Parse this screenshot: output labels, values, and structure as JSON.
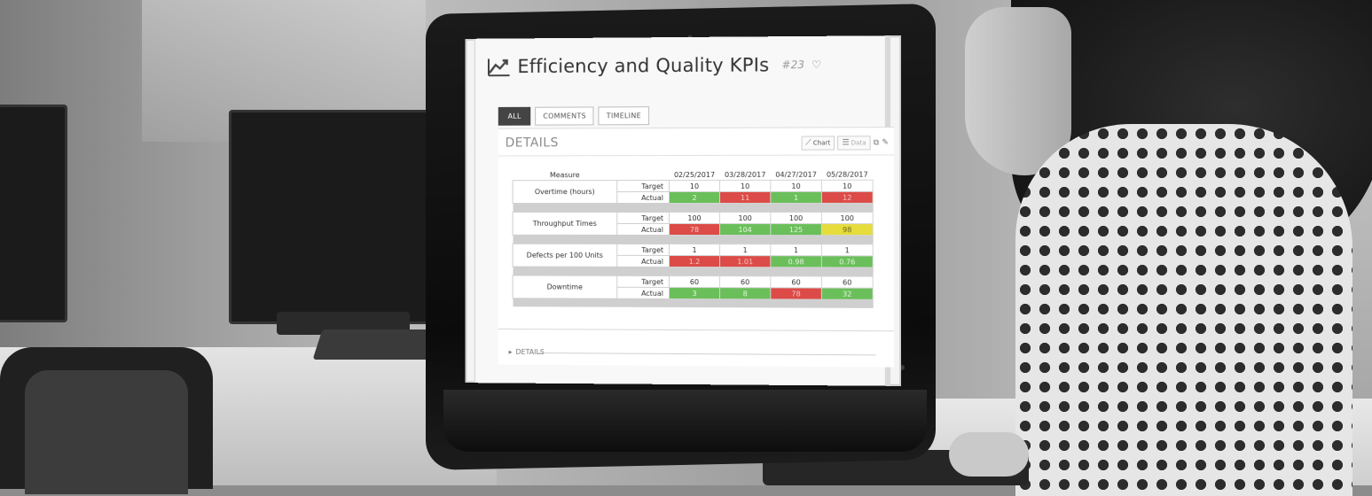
{
  "page": {
    "title": "Efficiency and Quality KPIs",
    "number": "#23",
    "favorite_icon": "heart-outline-icon",
    "title_icon": "line-chart-icon"
  },
  "tabs": [
    {
      "label": "ALL",
      "active": true
    },
    {
      "label": "COMMENTS",
      "active": false
    },
    {
      "label": "TIMELINE",
      "active": false
    }
  ],
  "details": {
    "title": "DETAILS",
    "chart_label": "Chart",
    "data_label": "Data",
    "collapsed_label": "DETAILS"
  },
  "table": {
    "measure_header": "Measure",
    "dates": [
      "02/25/2017",
      "03/28/2017",
      "04/27/2017",
      "05/28/2017"
    ],
    "rows": [
      {
        "name": "Overtime (hours)",
        "target_label": "Target",
        "actual_label": "Actual",
        "target": [
          "10",
          "10",
          "10",
          "10"
        ],
        "actual": [
          "2",
          "11",
          "1",
          "12"
        ],
        "status": [
          "green",
          "red",
          "green",
          "red"
        ]
      },
      {
        "name": "Throughput Times",
        "target_label": "Target",
        "actual_label": "Actual",
        "target": [
          "100",
          "100",
          "100",
          "100"
        ],
        "actual": [
          "78",
          "104",
          "125",
          "98"
        ],
        "status": [
          "red",
          "green",
          "green",
          "yellow"
        ]
      },
      {
        "name": "Defects per 100 Units",
        "target_label": "Target",
        "actual_label": "Actual",
        "target": [
          "1",
          "1",
          "1",
          "1"
        ],
        "actual": [
          "1.2",
          "1.01",
          "0.98",
          "0.76"
        ],
        "status": [
          "red",
          "red",
          "green",
          "green"
        ]
      },
      {
        "name": "Downtime",
        "target_label": "Target",
        "actual_label": "Actual",
        "target": [
          "60",
          "60",
          "60",
          "60"
        ],
        "actual": [
          "3",
          "8",
          "78",
          "32"
        ],
        "status": [
          "green",
          "green",
          "red",
          "green"
        ]
      }
    ]
  },
  "colors": {
    "green": "#6abf5a",
    "red": "#dc4b47",
    "yellow": "#e6dc3c"
  }
}
